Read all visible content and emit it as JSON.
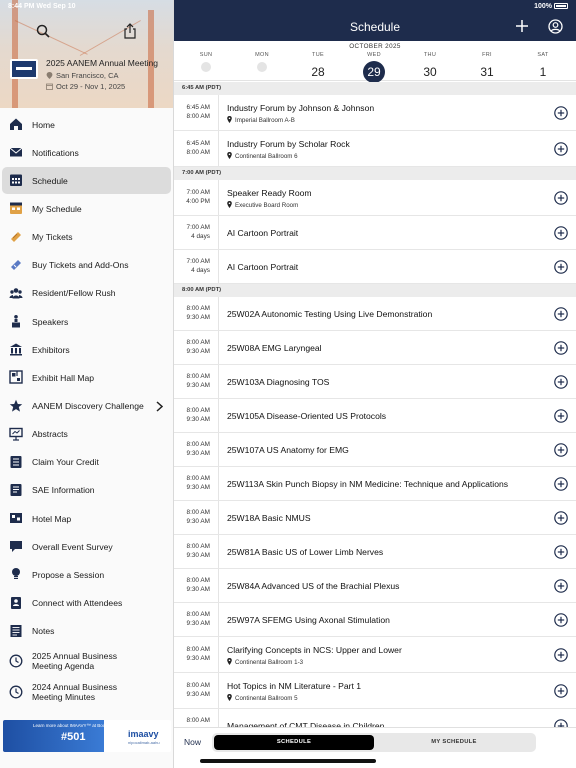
{
  "status_bar": {
    "time": "8:44 PM  Wed Sep 10",
    "battery": "100%"
  },
  "event": {
    "title": "2025 AANEM Annual Meeting",
    "location": "San Francisco, CA",
    "dates": "Oct 29 - Nov 1, 2025"
  },
  "sidebar": {
    "items": [
      {
        "label": "Home",
        "icon": "home-icon",
        "active": false
      },
      {
        "label": "Notifications",
        "icon": "envelope-icon",
        "active": false
      },
      {
        "label": "Schedule",
        "icon": "calendar-grid-icon",
        "active": true
      },
      {
        "label": "My Schedule",
        "icon": "calendar-star-icon",
        "active": false
      },
      {
        "label": "My Tickets",
        "icon": "ticket-icon",
        "active": false
      },
      {
        "label": "Buy Tickets and Add-Ons",
        "icon": "ticket-plus-icon",
        "active": false
      },
      {
        "label": "Resident/Fellow Rush",
        "icon": "group-icon",
        "active": false
      },
      {
        "label": "Speakers",
        "icon": "podium-icon",
        "active": false
      },
      {
        "label": "Exhibitors",
        "icon": "building-icon",
        "active": false
      },
      {
        "label": "Exhibit Hall Map",
        "icon": "floor-map-icon",
        "active": false
      },
      {
        "label": "AANEM Discovery Challenge",
        "icon": "star-icon",
        "active": false,
        "chevron": true
      },
      {
        "label": "Abstracts",
        "icon": "presentation-icon",
        "active": false
      },
      {
        "label": "Claim Your Credit",
        "icon": "list-icon",
        "active": false
      },
      {
        "label": "SAE Information",
        "icon": "document-icon",
        "active": false
      },
      {
        "label": "Hotel Map",
        "icon": "map-icon",
        "active": false
      },
      {
        "label": "Overall Event Survey",
        "icon": "speech-bubble-icon",
        "active": false
      },
      {
        "label": "Propose a Session",
        "icon": "lightbulb-icon",
        "active": false
      },
      {
        "label": "Connect with Attendees",
        "icon": "contact-icon",
        "active": false
      },
      {
        "label": "Notes",
        "icon": "notes-icon",
        "active": false
      },
      {
        "label": "2025 Annual Business Meeting Agenda",
        "icon": "clock-icon",
        "active": false
      },
      {
        "label": "2024 Annual Business Meeting Minutes",
        "icon": "clock-icon",
        "active": false
      }
    ]
  },
  "ad": {
    "text": "Learn more about IMAAVY™ at Booth",
    "booth": "#501",
    "brand": "imaavy",
    "brand_sub": "nipocalimab-aahu",
    "link": "Visit www.imaavyhcp.com"
  },
  "header": {
    "title": "Schedule"
  },
  "calendar": {
    "month": "OCTOBER 2025",
    "days": [
      {
        "name": "SUN",
        "num": "",
        "selected": false,
        "dot": true
      },
      {
        "name": "MON",
        "num": "",
        "selected": false,
        "dot": true
      },
      {
        "name": "TUE",
        "num": "28",
        "selected": false,
        "dot": false
      },
      {
        "name": "WED",
        "num": "29",
        "selected": true,
        "dot": false
      },
      {
        "name": "THU",
        "num": "30",
        "selected": false,
        "dot": false
      },
      {
        "name": "FRI",
        "num": "31",
        "selected": false,
        "dot": false
      },
      {
        "name": "SAT",
        "num": "1",
        "selected": false,
        "dot": false
      }
    ]
  },
  "schedule": {
    "groups": [
      {
        "header": "6:45 AM (PDT)",
        "sessions": [
          {
            "start": "6:45 AM",
            "end": "8:00 AM",
            "title": "Industry Forum by Johnson & Johnson",
            "room": "Imperial Ballroom A-B"
          },
          {
            "start": "6:45 AM",
            "end": "8:00 AM",
            "title": "Industry Forum by Scholar Rock",
            "room": "Continental Ballroom 6"
          }
        ]
      },
      {
        "header": "7:00 AM (PDT)",
        "sessions": [
          {
            "start": "7:00 AM",
            "end": "4:00 PM",
            "title": "Speaker Ready Room",
            "room": "Executive Board Room"
          },
          {
            "start": "7:00 AM",
            "end": "4 days",
            "title": "AI Cartoon Portrait",
            "room": ""
          },
          {
            "start": "7:00 AM",
            "end": "4 days",
            "title": "AI Cartoon Portrait",
            "room": ""
          }
        ]
      },
      {
        "header": "8:00 AM (PDT)",
        "sessions": [
          {
            "start": "8:00 AM",
            "end": "9:30 AM",
            "title": "25W02A Autonomic Testing Using Live Demonstration",
            "room": ""
          },
          {
            "start": "8:00 AM",
            "end": "9:30 AM",
            "title": "25W08A EMG Laryngeal",
            "room": ""
          },
          {
            "start": "8:00 AM",
            "end": "9:30 AM",
            "title": "25W103A Diagnosing TOS",
            "room": ""
          },
          {
            "start": "8:00 AM",
            "end": "9:30 AM",
            "title": "25W105A Disease-Oriented US Protocols",
            "room": ""
          },
          {
            "start": "8:00 AM",
            "end": "9:30 AM",
            "title": "25W107A US Anatomy for EMG",
            "room": ""
          },
          {
            "start": "8:00 AM",
            "end": "9:30 AM",
            "title": "25W113A Skin Punch Biopsy in NM Medicine: Technique and Applications",
            "room": ""
          },
          {
            "start": "8:00 AM",
            "end": "9:30 AM",
            "title": "25W18A Basic NMUS",
            "room": ""
          },
          {
            "start": "8:00 AM",
            "end": "9:30 AM",
            "title": "25W81A Basic US of Lower Limb Nerves",
            "room": ""
          },
          {
            "start": "8:00 AM",
            "end": "9:30 AM",
            "title": "25W84A Advanced US of the Brachial Plexus",
            "room": ""
          },
          {
            "start": "8:00 AM",
            "end": "9:30 AM",
            "title": "25W97A SFEMG Using Axonal Stimulation",
            "room": ""
          },
          {
            "start": "8:00 AM",
            "end": "9:30 AM",
            "title": "Clarifying Concepts in NCS: Upper and Lower",
            "room": "Continental Ballroom 1-3"
          },
          {
            "start": "8:00 AM",
            "end": "9:30 AM",
            "title": "Hot Topics in NM Literature - Part 1",
            "room": "Continental Ballroom 5"
          },
          {
            "start": "8:00 AM",
            "end": "",
            "title": "Management of CMT Disease in Children",
            "room": ""
          }
        ]
      }
    ]
  },
  "bottom_bar": {
    "now_label": "Now",
    "tab_schedule": "SCHEDULE",
    "tab_my_schedule": "MY SCHEDULE"
  },
  "colors": {
    "navy": "#1e2c4c",
    "active_row": "#dcdcdc",
    "header_band": "#ececec"
  }
}
